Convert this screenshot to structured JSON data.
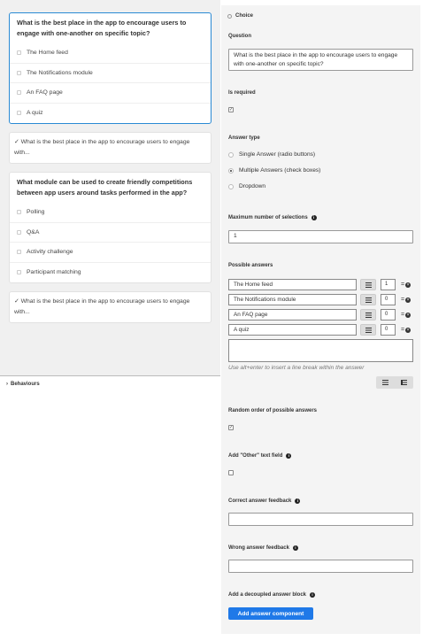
{
  "left": {
    "cards": [
      {
        "title": "What is the best place in the app to encourage users to engage with one-another on specific topic?",
        "items": [
          "The Home feed",
          "The Notifications module",
          "An FAQ page",
          "A quiz"
        ]
      },
      {
        "summary": "✓ What is the best place in the app to encourage users to engage with..."
      },
      {
        "title": "What module can be used to create friendly competitions between app users around tasks performed in the app?",
        "items": [
          "Polling",
          "Q&A",
          "Activity challenge",
          "Participant matching"
        ]
      },
      {
        "summary": "✓ What is the best place in the app to encourage users to engage with..."
      }
    ],
    "behaviours_label": "Behaviours"
  },
  "right": {
    "header": "Choice",
    "question_label": "Question",
    "question_value": "What is the best place in the app to encourage users to engage with one-another on specific topic?",
    "is_required_label": "Is required",
    "answer_type_label": "Answer type",
    "answer_types": [
      "Single Answer (radio buttons)",
      "Multiple Answers (check boxes)",
      "Dropdown"
    ],
    "answer_type_selected": "Multiple Answers (check boxes)",
    "max_selections_label": "Maximum number of selections",
    "max_selections_value": "1",
    "possible_answers_label": "Possible answers",
    "possible_answers": [
      {
        "text": "The Home feed",
        "score": "1"
      },
      {
        "text": "The Notifications module",
        "score": "0"
      },
      {
        "text": "An FAQ page",
        "score": "0"
      },
      {
        "text": "A quiz",
        "score": "0"
      }
    ],
    "hint": "Use alt+enter to insert a line break within the answer",
    "random_order_label": "Random order of possible answers",
    "other_field_label": "Add \"Other\" text field",
    "correct_feedback_label": "Correct answer feedback",
    "wrong_feedback_label": "Wrong answer feedback",
    "decoupled_label": "Add a decoupled answer block",
    "add_component_button": "Add answer component"
  },
  "colors": {
    "accent": "#1f79e8",
    "active_border": "#2a8ad4"
  }
}
